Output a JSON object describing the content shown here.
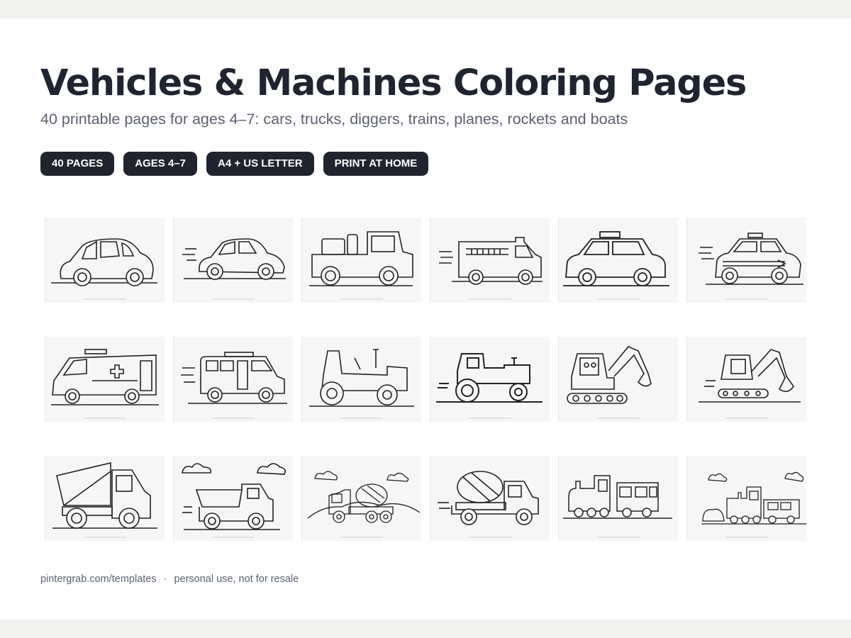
{
  "title": "Vehicles & Machines Coloring Pages",
  "subtitle": "40 printable pages for ages 4–7: cars, trucks, diggers, trains, planes, rockets and boats",
  "badges": [
    "40 PAGES",
    "AGES 4–7",
    "A4 + US LETTER",
    "PRINT AT HOME"
  ],
  "thumbnails": [
    {
      "icon": "car-icon"
    },
    {
      "icon": "car-icon"
    },
    {
      "icon": "pickup-truck-icon"
    },
    {
      "icon": "fire-truck-icon"
    },
    {
      "icon": "taxi-icon"
    },
    {
      "icon": "police-car-icon"
    },
    {
      "icon": "ambulance-icon"
    },
    {
      "icon": "van-icon"
    },
    {
      "icon": "tractor-icon"
    },
    {
      "icon": "tractor-icon"
    },
    {
      "icon": "excavator-icon"
    },
    {
      "icon": "excavator-icon"
    },
    {
      "icon": "dump-truck-icon"
    },
    {
      "icon": "dump-truck-icon"
    },
    {
      "icon": "cement-mixer-icon"
    },
    {
      "icon": "cement-mixer-icon"
    },
    {
      "icon": "train-icon"
    },
    {
      "icon": "train-icon"
    }
  ],
  "footer": {
    "site": "pintergrab.com/templates",
    "separator": "·",
    "note": "personal use, not for resale"
  }
}
